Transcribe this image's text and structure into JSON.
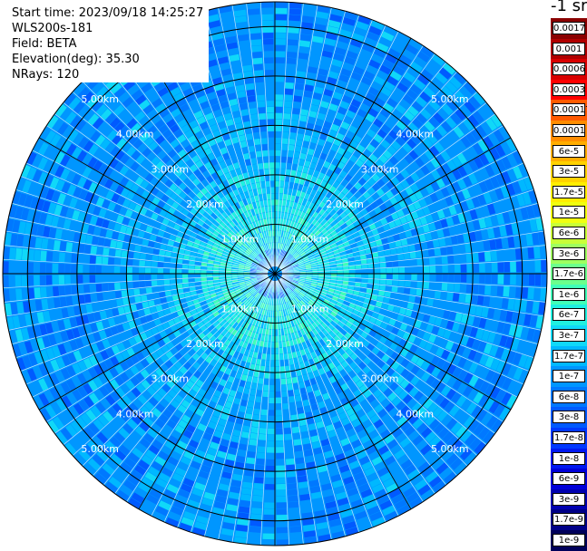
{
  "header": {
    "start_time": "Start time: 2023/09/18 14:25:27",
    "instrument": "WLS200s-181",
    "field": "Field: BETA",
    "elevation": "Elevation(deg): 35.30",
    "nrays": "NRays: 120"
  },
  "colorbar": {
    "unit": "-1 sr",
    "labels": [
      "0.0017",
      "0.001",
      "0.0006",
      "0.0003",
      "0.00017",
      "0.0001",
      "6e-5",
      "3e-5",
      "1.7e-5",
      "1e-5",
      "6e-6",
      "3e-6",
      "1.7e-6",
      "1e-6",
      "6e-7",
      "3e-7",
      "1.7e-7",
      "1e-7",
      "6e-8",
      "3e-8",
      "1.7e-8",
      "1e-8",
      "6e-9",
      "3e-9",
      "1.7e-9",
      "1e-9"
    ],
    "colors": [
      "#8a0000",
      "#b00000",
      "#d80000",
      "#ff0000",
      "#ff5a00",
      "#ff8c00",
      "#ffad00",
      "#ffd200",
      "#ffee00",
      "#f0ff10",
      "#c8ff38",
      "#9eff60",
      "#6cff8c",
      "#40ffb8",
      "#20f0e0",
      "#10d8f8",
      "#00b8ff",
      "#0096ff",
      "#0078ff",
      "#005aff",
      "#0038ff",
      "#0018f0",
      "#0000d8",
      "#0000b0",
      "#000088",
      "#00005a"
    ]
  },
  "chart_data": {
    "type": "heatmap",
    "projection": "polar PPI",
    "field": "BETA",
    "nrays": 120,
    "range_km_max": 5.5,
    "range_rings_km": [
      1.0,
      2.0,
      3.0,
      4.0,
      5.0
    ],
    "ring_labels": [
      "1.00km",
      "2.00km",
      "3.00km",
      "4.00km",
      "5.00km"
    ],
    "colorscale": "log",
    "value_range": [
      1e-09,
      0.0017
    ],
    "dominant_values": {
      "near_center": "1e-7 to 3e-7",
      "outer": "3e-8 to 1e-8"
    }
  }
}
